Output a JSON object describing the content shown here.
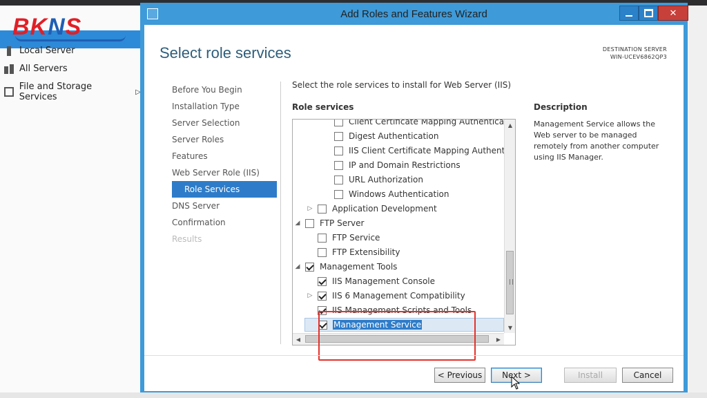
{
  "background": {
    "logo_text": "BKNS",
    "sidebar_items": [
      {
        "label": "Local Server",
        "icon": "server-icon"
      },
      {
        "label": "All Servers",
        "icon": "servers-icon"
      },
      {
        "label": "File and Storage Services",
        "icon": "storage-icon"
      }
    ]
  },
  "window": {
    "title": "Add Roles and Features Wizard"
  },
  "page": {
    "heading": "Select role services",
    "destination_label": "DESTINATION SERVER",
    "destination_server": "WIN-UCEV6862QP3",
    "instruction": "Select the role services to install for Web Server (IIS)",
    "role_services_label": "Role services",
    "description_label": "Description",
    "description_text": "Management Service allows the Web server to be managed remotely from another computer using IIS Manager."
  },
  "steps": [
    {
      "label": "Before You Begin",
      "state": "normal"
    },
    {
      "label": "Installation Type",
      "state": "normal"
    },
    {
      "label": "Server Selection",
      "state": "normal"
    },
    {
      "label": "Server Roles",
      "state": "normal"
    },
    {
      "label": "Features",
      "state": "normal"
    },
    {
      "label": "Web Server Role (IIS)",
      "state": "normal"
    },
    {
      "label": "Role Services",
      "state": "active"
    },
    {
      "label": "DNS Server",
      "state": "normal"
    },
    {
      "label": "Confirmation",
      "state": "normal"
    },
    {
      "label": "Results",
      "state": "disabled"
    }
  ],
  "tree": {
    "items": [
      {
        "label": "Client Certificate Mapping Authentication",
        "checked": false
      },
      {
        "label": "Digest Authentication",
        "checked": false
      },
      {
        "label": "IIS Client Certificate Mapping Authentication",
        "checked": false
      },
      {
        "label": "IP and Domain Restrictions",
        "checked": false
      },
      {
        "label": "URL Authorization",
        "checked": false
      },
      {
        "label": "Windows Authentication",
        "checked": false
      },
      {
        "label": "Application Development",
        "checked": false
      },
      {
        "label": "FTP Server",
        "checked": false
      },
      {
        "label": "FTP Service",
        "checked": false
      },
      {
        "label": "FTP Extensibility",
        "checked": false
      },
      {
        "label": "Management Tools",
        "checked": true
      },
      {
        "label": "IIS Management Console",
        "checked": true
      },
      {
        "label": "IIS 6 Management Compatibility",
        "checked": true
      },
      {
        "label": "IIS Management Scripts and Tools",
        "checked": true
      },
      {
        "label": "Management Service",
        "checked": true
      }
    ]
  },
  "buttons": {
    "previous": "< Previous",
    "next": "Next >",
    "install": "Install",
    "cancel": "Cancel"
  },
  "colors": {
    "window_frame": "#3e9ad8",
    "active_step": "#2e7cc9",
    "highlight_box": "#e4322b"
  }
}
